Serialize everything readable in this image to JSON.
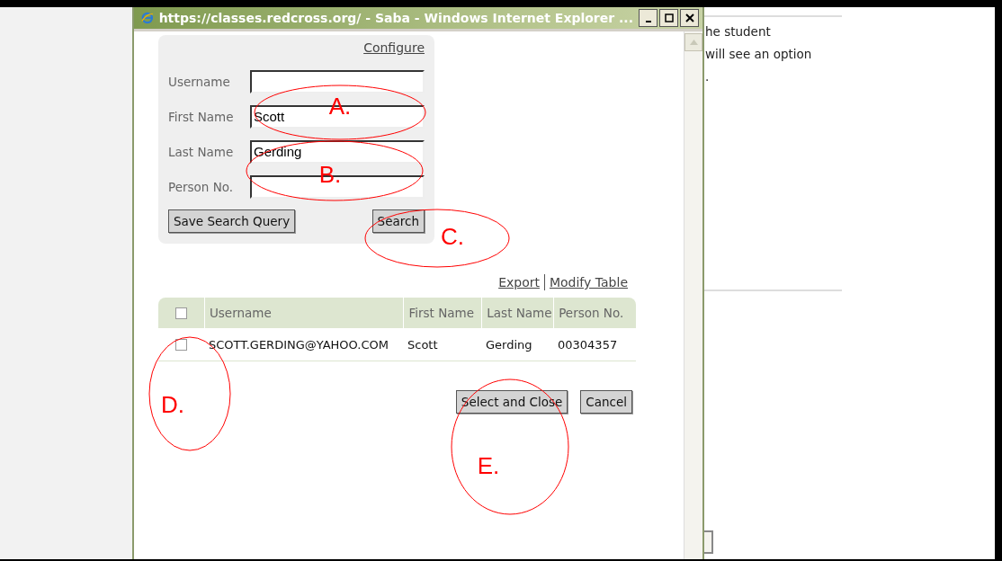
{
  "window": {
    "title": "https://classes.redcross.org/ - Saba - Windows Internet Explorer ..."
  },
  "search_panel": {
    "configure_link": "Configure",
    "fields": [
      {
        "label": "Username"
      },
      {
        "label": "First Name",
        "value": "Scott"
      },
      {
        "label": "Last Name",
        "value": "Gerding"
      },
      {
        "label": "Person No."
      }
    ],
    "buttons": [
      "Save Search Query",
      "Search"
    ]
  },
  "table_links": [
    "Export",
    "Modify Table"
  ],
  "table": {
    "select_all_checked": false,
    "columns": [
      "Username",
      "First Name",
      "Last Name",
      "Person No."
    ],
    "rows": [
      {
        "checked": false,
        "cells": [
          "SCOTT.GERDING@YAHOO.COM",
          "Scott",
          "Gerding",
          "00304357"
        ]
      }
    ]
  },
  "dialog_buttons": [
    "Select and Close",
    "Cancel"
  ],
  "background_page": {
    "lines": [
      "he student",
      "will see an option",
      "."
    ]
  },
  "annotations": [
    "A.",
    "B.",
    "C.",
    "D.",
    "E."
  ]
}
